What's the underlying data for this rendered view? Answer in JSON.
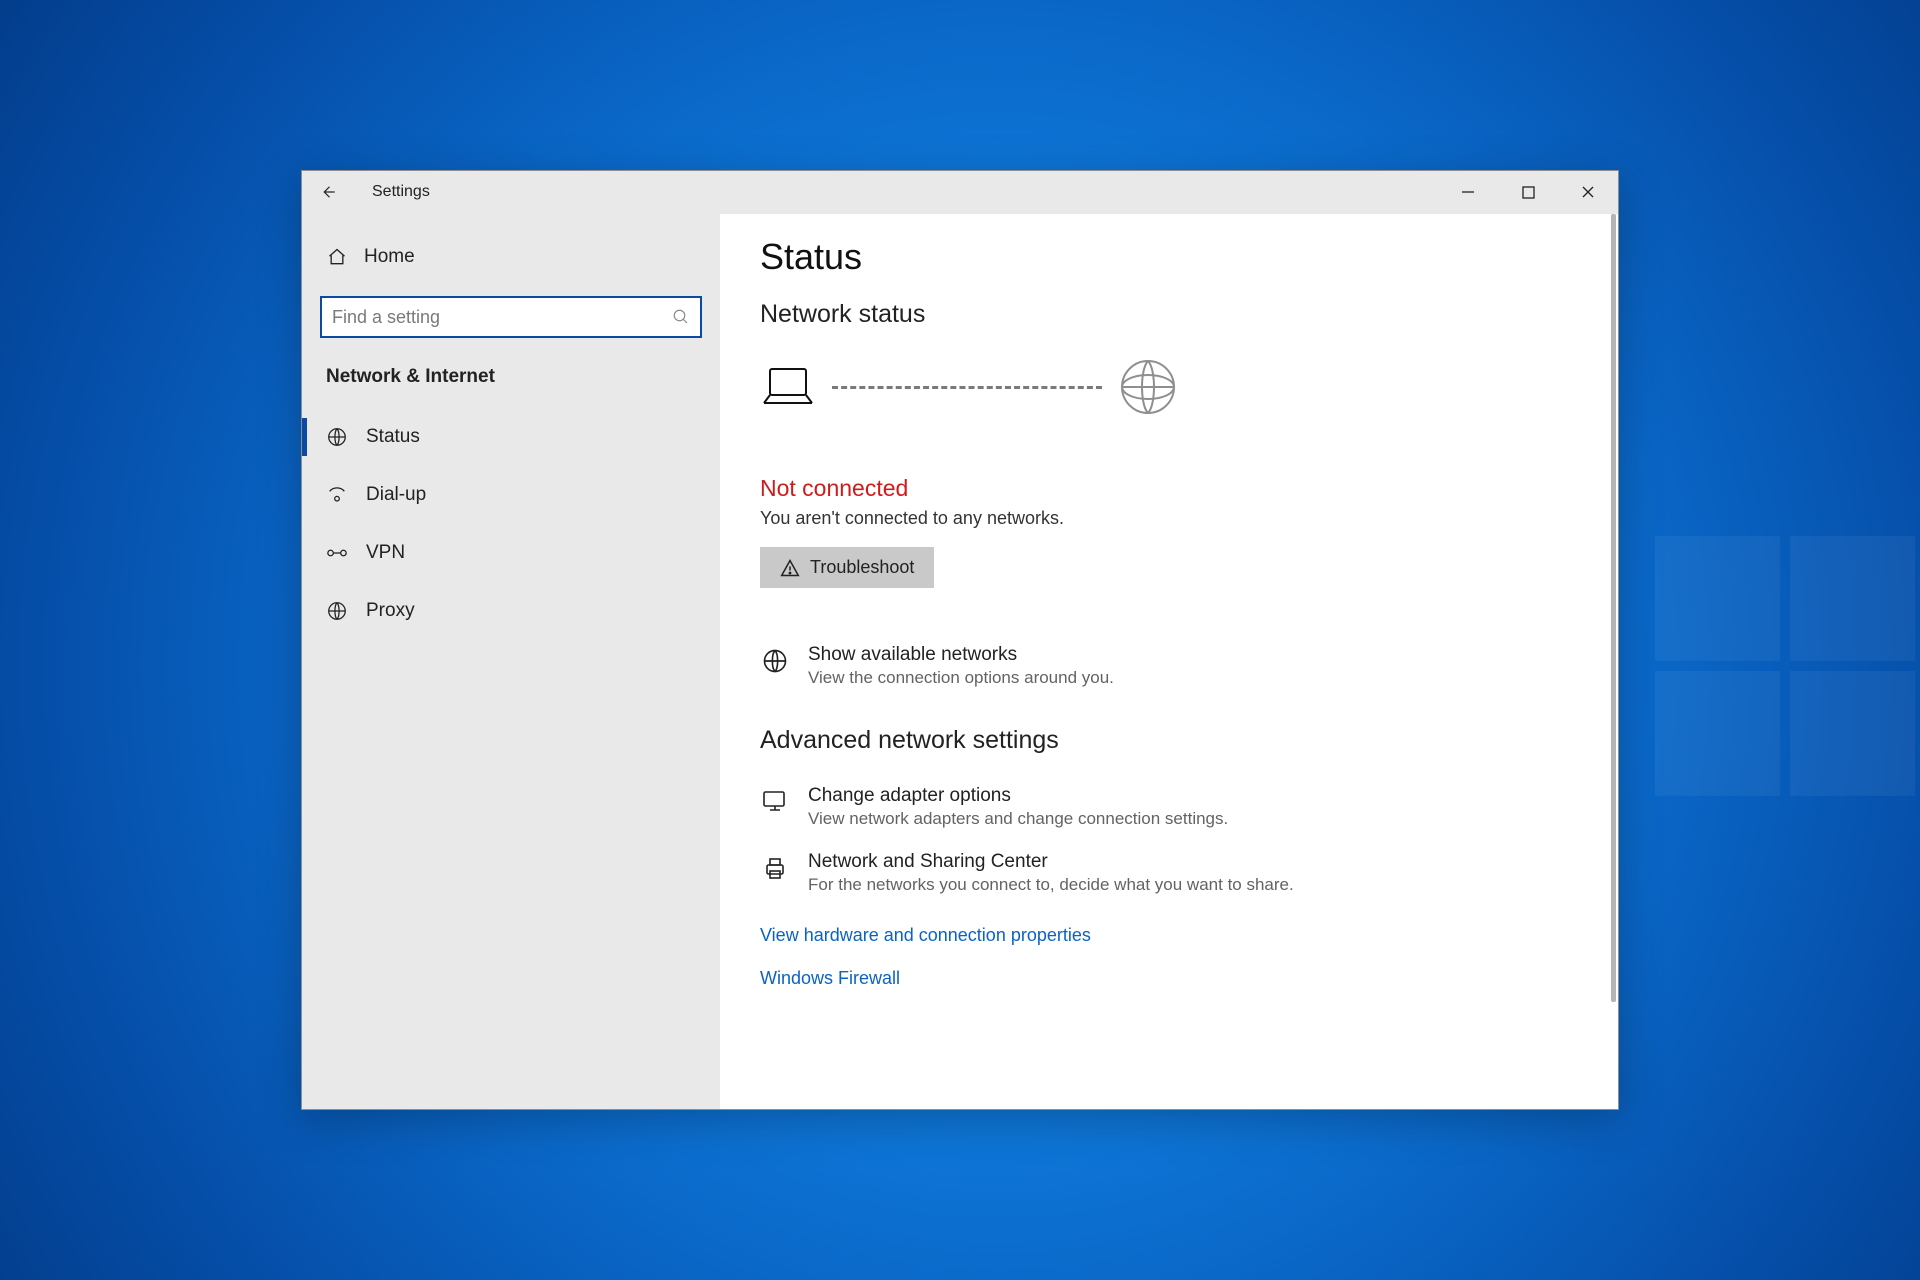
{
  "app_title": "Settings",
  "search": {
    "placeholder": "Find a setting"
  },
  "sidebar": {
    "home_label": "Home",
    "category": "Network & Internet",
    "items": [
      {
        "label": "Status",
        "selected": true
      },
      {
        "label": "Dial-up",
        "selected": false
      },
      {
        "label": "VPN",
        "selected": false
      },
      {
        "label": "Proxy",
        "selected": false
      }
    ]
  },
  "main": {
    "title": "Status",
    "section1_title": "Network status",
    "status_heading": "Not connected",
    "status_sub": "You aren't connected to any networks.",
    "troubleshoot_label": "Troubleshoot",
    "show_networks": {
      "title": "Show available networks",
      "sub": "View the connection options around you."
    },
    "section2_title": "Advanced network settings",
    "adapter": {
      "title": "Change adapter options",
      "sub": "View network adapters and change connection settings."
    },
    "sharing": {
      "title": "Network and Sharing Center",
      "sub": "For the networks you connect to, decide what you want to share."
    },
    "link_hw": "View hardware and connection properties",
    "link_fw": "Windows Firewall"
  }
}
